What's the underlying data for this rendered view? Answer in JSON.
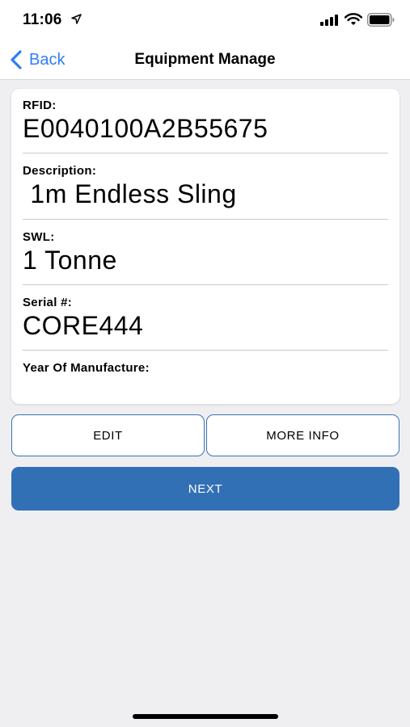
{
  "status_bar": {
    "time": "11:06",
    "icons": [
      "location-arrow-icon",
      "cellular-signal-icon",
      "wifi-icon",
      "battery-icon"
    ]
  },
  "nav": {
    "back_label": "Back",
    "title": "Equipment Manage"
  },
  "fields": [
    {
      "label": "RFID:",
      "value": "E0040100A2B55675"
    },
    {
      "label": "Description:",
      "value": " 1m Endless Sling"
    },
    {
      "label": "SWL:",
      "value": "1 Tonne"
    },
    {
      "label": "Serial #:",
      "value": "CORE444"
    },
    {
      "label": "Year Of Manufacture:",
      "value": ""
    }
  ],
  "buttons": {
    "edit_label": "EDIT",
    "more_info_label": "MORE INFO",
    "next_label": "NEXT"
  },
  "colors": {
    "accent": "#2f7df6",
    "primary_button": "#3270b6",
    "background": "#efeff1"
  }
}
